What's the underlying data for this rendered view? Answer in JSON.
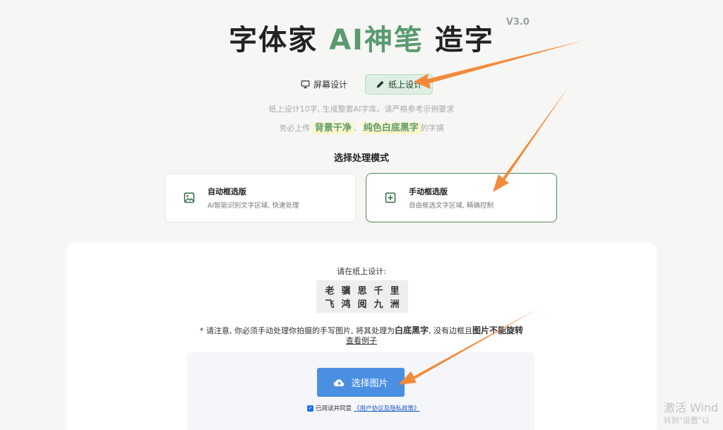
{
  "header": {
    "title_part1": "字体家 ",
    "title_accent": "AI神笔",
    "title_part2": " 造字",
    "version": "V3.0"
  },
  "modes": {
    "screen_label": "屏幕设计",
    "paper_label": "纸上设计"
  },
  "hint": {
    "line1": "纸上设计10字, 生成整套AI字库。请严格参考示例要求",
    "line2_prefix": "务必上传",
    "hl1": "背景干净",
    "sep": "、",
    "hl2": "纯色白底黑字",
    "line2_suffix": "的字搞"
  },
  "process": {
    "section_title": "选择处理模式",
    "auto_title": "自动框选版",
    "auto_desc": "AI智能识别文字区域, 快速处理",
    "manual_title": "手动框选版",
    "manual_desc": "自由框选文字区域, 精确控制"
  },
  "design": {
    "prompt": "请在纸上设计:",
    "row1": [
      "老",
      "骥",
      "思",
      "千",
      "里"
    ],
    "row2": [
      "飞",
      "鸿",
      "阅",
      "九",
      "洲"
    ],
    "note_prefix": "* 请注意, 你必须手动处理你拍摄的手写图片, 将其处理为",
    "note_bold1": "白底黑字",
    "note_mid": ", 没有边框且",
    "note_bold2": "图片不能旋转",
    "example_link": "查看例子"
  },
  "upload": {
    "button_label": "选择图片",
    "agree_text": "已阅读并同意",
    "agree_link": "《用户协议及隐私政策》"
  },
  "watermark": {
    "line1": "激活 Wind",
    "line2": "转到\"设置\"以"
  },
  "colors": {
    "accent_green": "#5a9a6e",
    "upload_blue": "#4a8fe2",
    "arrow_orange": "#f28a3c"
  }
}
